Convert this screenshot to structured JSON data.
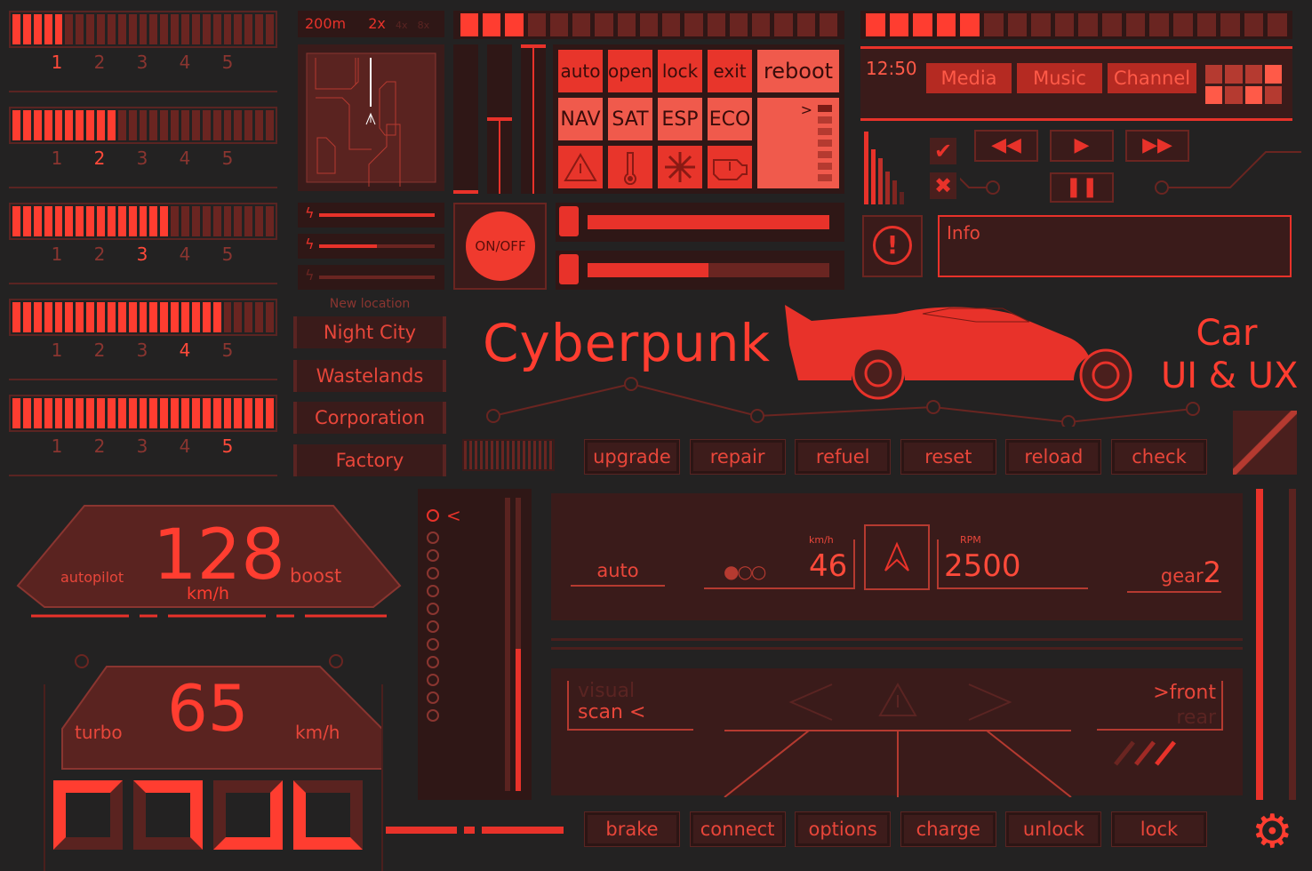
{
  "colors": {
    "accent": "#ff3d30",
    "panel": "#3a1b1a",
    "background": "#232222"
  },
  "gear_selectors": [
    {
      "fill": 1,
      "numbers": [
        "1",
        "2",
        "3",
        "4",
        "5"
      ],
      "selected": 1
    },
    {
      "fill": 2,
      "numbers": [
        "1",
        "2",
        "3",
        "4",
        "5"
      ],
      "selected": 2
    },
    {
      "fill": 3,
      "numbers": [
        "1",
        "2",
        "3",
        "4",
        "5"
      ],
      "selected": 3
    },
    {
      "fill": 4,
      "numbers": [
        "1",
        "2",
        "3",
        "4",
        "5"
      ],
      "selected": 4
    },
    {
      "fill": 5,
      "numbers": [
        "1",
        "2",
        "3",
        "4",
        "5"
      ],
      "selected": 5
    }
  ],
  "map": {
    "distance": "200m",
    "zoom_options": [
      "2x",
      "4x",
      "8x"
    ],
    "selected_zoom": "2x"
  },
  "top_segments_active": 3,
  "controls": {
    "row1": [
      "auto",
      "open",
      "lock",
      "exit"
    ],
    "reboot": "reboot",
    "row2": [
      "NAV",
      "SAT",
      "ESP",
      "ECO"
    ],
    "icons": [
      "warning-icon",
      "thermometer-icon",
      "fan-icon",
      "engine-warning-icon"
    ],
    "list_arrow": ">"
  },
  "power_levels": [
    1.0,
    0.5,
    0.0
  ],
  "power_button": "ON/OFF",
  "fuel_levels": [
    1.0,
    0.5
  ],
  "media": {
    "time": "12:50",
    "tabs": [
      "Media",
      "Music",
      "Channel"
    ]
  },
  "info": {
    "label": "Info"
  },
  "locations": {
    "header": "New location",
    "items": [
      "Night City",
      "Wastelands",
      "Corporation",
      "Factory"
    ]
  },
  "title": {
    "main": "Cyberpunk",
    "sub1": "Car",
    "sub2": "UI & UX"
  },
  "actions": [
    "upgrade",
    "repair",
    "refuel",
    "reset",
    "reload",
    "check"
  ],
  "speedo": {
    "left": "autopilot",
    "speed": "128",
    "unit": "km/h",
    "right": "boost"
  },
  "turbo": {
    "left": "turbo",
    "speed": "65",
    "unit": "km/h"
  },
  "list_arrow": "<",
  "dash": {
    "mode": "auto",
    "speed_unit": "km/h",
    "speed": "46",
    "rpm_label": "RPM",
    "rpm": "2500",
    "gear_label": "gear",
    "gear": "2"
  },
  "scan": {
    "line1": "visual",
    "line2": "scan <",
    "front": ">front",
    "rear": "rear"
  },
  "bottom_buttons": [
    "brake",
    "connect",
    "options",
    "charge",
    "unlock",
    "lock"
  ]
}
